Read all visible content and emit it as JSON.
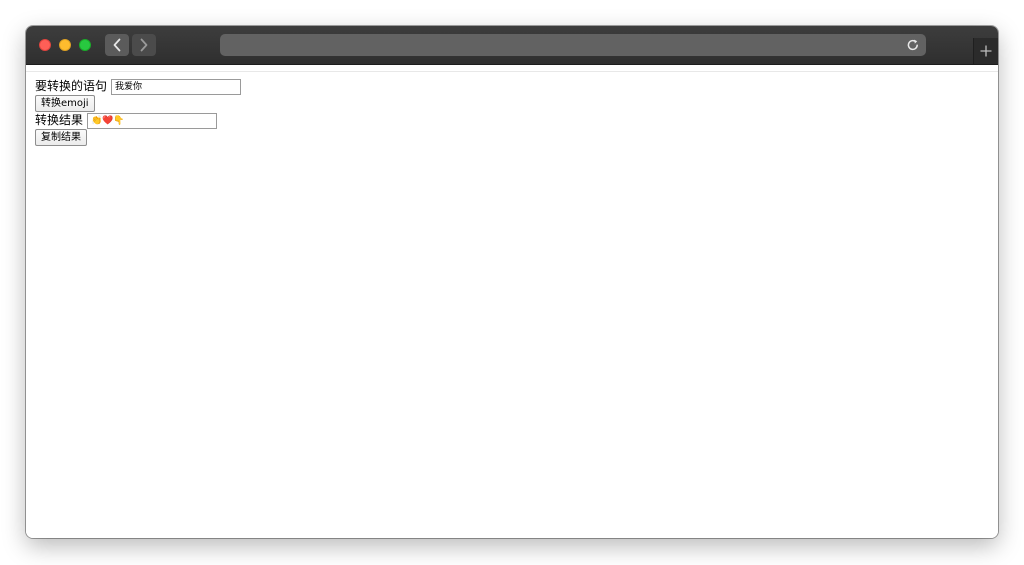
{
  "browser": {
    "back_icon": "chevron-left-icon",
    "forward_icon": "chevron-right-icon",
    "reload_icon": "reload-icon",
    "new_tab_icon": "plus-icon",
    "url": ""
  },
  "form": {
    "input_label": "要转换的语句",
    "input_value": "我爱你",
    "convert_button": "转换emoji",
    "result_label": "转换结果",
    "result_value": "👏❤️👇",
    "copy_button": "复制结果"
  },
  "colors": {
    "titlebar": "#3a3a3a",
    "traffic_red": "#fe5f57",
    "traffic_yellow": "#febc2e",
    "traffic_green": "#28c840",
    "urlbar": "#626262"
  }
}
